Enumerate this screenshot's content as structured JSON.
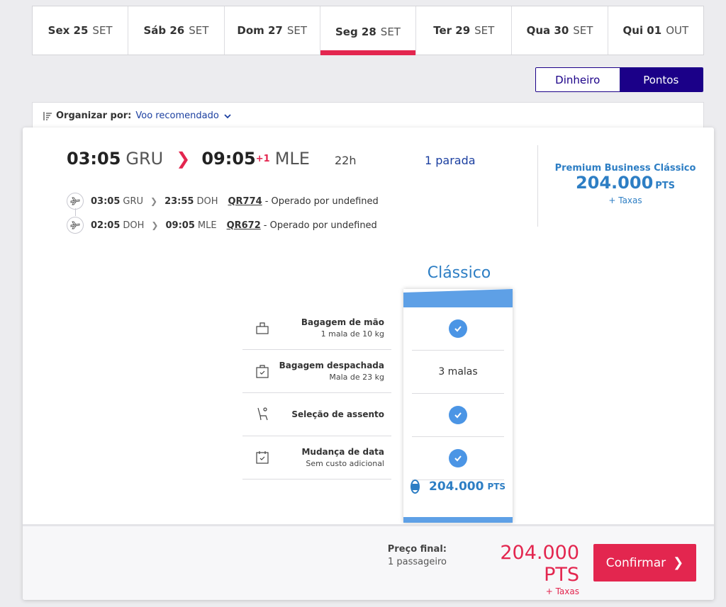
{
  "date_tabs": [
    {
      "day": "Sex 25",
      "month": "SET"
    },
    {
      "day": "Sáb 26",
      "month": "SET"
    },
    {
      "day": "Dom 27",
      "month": "SET"
    },
    {
      "day": "Seg 28",
      "month": "SET",
      "active": true
    },
    {
      "day": "Ter 29",
      "month": "SET"
    },
    {
      "day": "Qua 30",
      "month": "SET"
    },
    {
      "day": "Qui 01",
      "month": "OUT"
    }
  ],
  "currency_toggle": {
    "money": "Dinheiro",
    "points": "Pontos",
    "selected": "Pontos"
  },
  "sort": {
    "label": "Organizar por:",
    "value": "Voo recomendado"
  },
  "flight": {
    "depart_time": "03:05",
    "depart_airport": "GRU",
    "arrive_time": "09:05",
    "day_offset": "+1",
    "arrive_airport": "MLE",
    "duration": "22h",
    "stops": "1 parada",
    "segments": [
      {
        "dep_time": "03:05",
        "dep_airport": "GRU",
        "arr_time": "23:55",
        "arr_airport": "DOH",
        "flight_number": "QR774",
        "operator": "- Operado por undefined"
      },
      {
        "dep_time": "02:05",
        "dep_airport": "DOH",
        "arr_time": "09:05",
        "arr_airport": "MLE",
        "flight_number": "QR672",
        "operator": "- Operado por undefined"
      }
    ]
  },
  "fare_summary": {
    "class": "Premium Business Clássico",
    "points": "204.000",
    "unit": "PTS",
    "taxes": "+ Taxas"
  },
  "fare_option": {
    "name": "Clássico",
    "checked_bag_value": "3 malas",
    "points": "204.000",
    "unit": "PTS"
  },
  "features": [
    {
      "title": "Bagagem de mão",
      "subtitle": "1 mala de 10 kg",
      "icon": "carry-on-bag-icon"
    },
    {
      "title": "Bagagem despachada",
      "subtitle": "Mala de 23 kg",
      "icon": "checked-bag-icon"
    },
    {
      "title": "Seleção de assento",
      "subtitle": "",
      "icon": "seat-icon"
    },
    {
      "title": "Mudança de data",
      "subtitle": "Sem custo adicional",
      "icon": "calendar-icon"
    }
  ],
  "footer": {
    "final_label": "Preço final:",
    "passengers": "1 passageiro",
    "price": "204.000 PTS",
    "taxes": "+ Taxas",
    "confirm_label": "Confirmar"
  },
  "colors": {
    "accent_red": "#e3264f",
    "brand_navy": "#1b0088",
    "fare_blue": "#2d7ec4"
  }
}
